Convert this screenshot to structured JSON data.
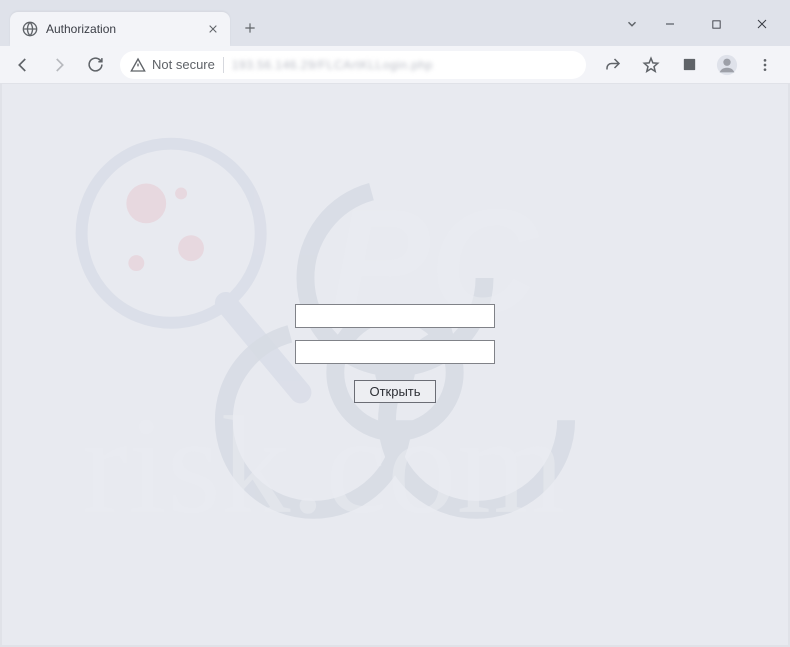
{
  "tab": {
    "title": "Authorization"
  },
  "toolbar": {
    "not_secure_label": "Not secure",
    "url_obfuscated": "193.56.146.29/FLCArtKLLogin.php"
  },
  "form": {
    "input1_value": "",
    "input2_value": "",
    "submit_label": "Открыть"
  }
}
